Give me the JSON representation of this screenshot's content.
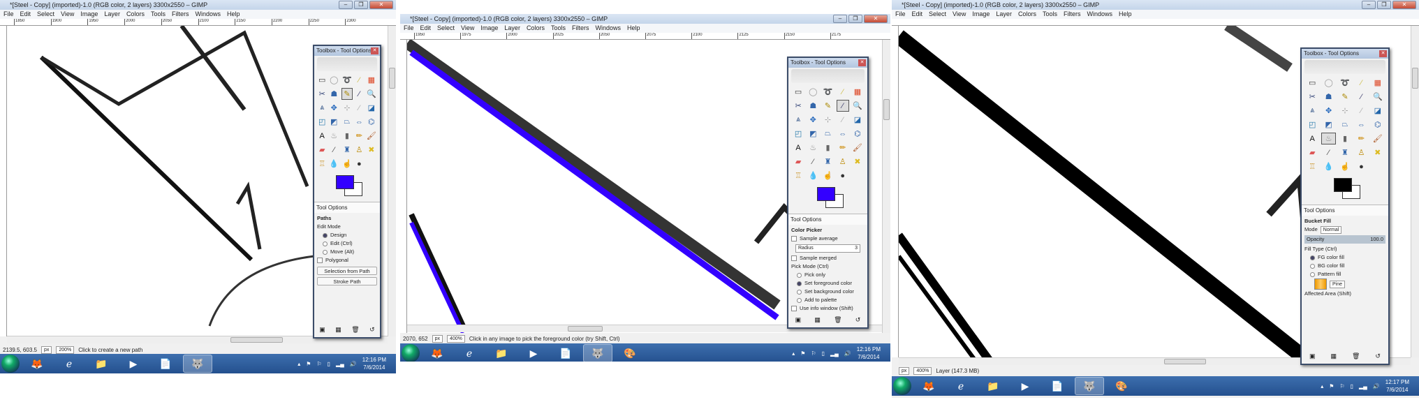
{
  "windows": [
    {
      "title": "*[Steel - Copy] (imported)-1.0 (RGB color, 2 layers) 3300x2550 – GIMP",
      "menu": [
        "File",
        "Edit",
        "Select",
        "View",
        "Image",
        "Layer",
        "Colors",
        "Tools",
        "Filters",
        "Windows",
        "Help"
      ],
      "ruler": [
        "1850",
        "1900",
        "1950",
        "2000",
        "2050",
        "2100",
        "2150",
        "2200",
        "2250",
        "2300"
      ],
      "status": {
        "coords": "2139.5, 603.5",
        "unit": "px",
        "zoom": "200%",
        "message": "Click to create a new path"
      },
      "toolbox": {
        "title": "Toolbox - Tool Options",
        "fg_color": "#3300ff",
        "active_tool": 7,
        "tab": "Tool Options",
        "options": {
          "heading": "Paths",
          "group": "Edit Mode",
          "radios": [
            "Design",
            "Edit (Ctrl)",
            "Move (Alt)"
          ],
          "checked": 0,
          "checkbox": "Polygonal",
          "buttons": [
            "Selection from Path",
            "Stroke Path"
          ]
        }
      },
      "taskbar": {
        "time": "12:16 PM",
        "date": "7/6/2014"
      }
    },
    {
      "title": "*[Steel - Copy] (imported)-1.0 (RGB color, 2 layers) 3300x2550 – GIMP",
      "menu": [
        "File",
        "Edit",
        "Select",
        "View",
        "Image",
        "Layer",
        "Colors",
        "Tools",
        "Filters",
        "Windows",
        "Help"
      ],
      "ruler": [
        "1950",
        "1975",
        "2000",
        "2025",
        "2050",
        "2075",
        "2100",
        "2125",
        "2150",
        "2175"
      ],
      "status": {
        "coords": "2070, 652",
        "unit": "px",
        "zoom": "400%",
        "message": "Click in any image to pick the foreground color (try Shift, Ctrl)"
      },
      "toolbox": {
        "title": "Toolbox - Tool Options",
        "fg_color": "#3300ff",
        "active_tool": 8,
        "tab": "Tool Options",
        "options": {
          "heading": "Color Picker",
          "checkboxes": [
            "Sample average",
            "Sample merged"
          ],
          "radius_label": "Radius",
          "radius_value": "3",
          "group": "Pick Mode (Ctrl)",
          "radios": [
            "Pick only",
            "Set foreground color",
            "Set background color",
            "Add to palette"
          ],
          "checked": 1,
          "checkbox": "Use info window (Shift)"
        }
      },
      "taskbar": {
        "time": "12:16 PM",
        "date": "7/6/2014"
      }
    },
    {
      "title": "*[Steel - Copy] (imported)-1.0 (RGB color, 2 layers) 3300x2550 – GIMP",
      "menu": [
        "File",
        "Edit",
        "Select",
        "View",
        "Image",
        "Layer",
        "Colors",
        "Tools",
        "Filters",
        "Windows",
        "Help"
      ],
      "ruler": [],
      "status": {
        "coords": "",
        "unit": "px",
        "zoom": "400%",
        "message": "Layer (147.3 MB)"
      },
      "toolbox": {
        "title": "Toolbox - Tool Options",
        "fg_color": "#000000",
        "active_tool": 21,
        "tab": "Tool Options",
        "options": {
          "heading": "Bucket Fill",
          "mode_label": "Mode",
          "mode_value": "Normal",
          "opacity_label": "Opacity",
          "opacity_value": "100.0",
          "group": "Fill Type (Ctrl)",
          "radios": [
            "FG color fill",
            "BG color fill",
            "Pattern fill"
          ],
          "checked": 0,
          "pattern_name": "Pine",
          "group2": "Affected Area (Shift)"
        }
      },
      "taskbar": {
        "time": "12:17 PM",
        "date": "7/6/2014"
      }
    }
  ],
  "tools": [
    {
      "icon": "rect-select-icon",
      "g": "▭",
      "c": "#333"
    },
    {
      "icon": "ellipse-select-icon",
      "g": "◯",
      "c": "#999"
    },
    {
      "icon": "free-select-icon",
      "g": "➰",
      "c": "#888"
    },
    {
      "icon": "fuzzy-select-icon",
      "g": "⁄",
      "c": "#cb4"
    },
    {
      "icon": "select-by-color-icon",
      "g": "▦",
      "c": "#d42"
    },
    {
      "icon": "scissors-select-icon",
      "g": "✂",
      "c": "#347"
    },
    {
      "icon": "foreground-select-icon",
      "g": "☗",
      "c": "#36a"
    },
    {
      "icon": "paths-icon",
      "g": "✎",
      "c": "#a80"
    },
    {
      "icon": "color-picker-icon",
      "g": "⁄",
      "c": "#336"
    },
    {
      "icon": "zoom-icon",
      "g": "🔍",
      "c": "#69c"
    },
    {
      "icon": "measure-icon",
      "g": "⩓",
      "c": "#358"
    },
    {
      "icon": "move-icon",
      "g": "✥",
      "c": "#26b"
    },
    {
      "icon": "align-icon",
      "g": "⊹",
      "c": "#999"
    },
    {
      "icon": "crop-icon",
      "g": "⁄",
      "c": "#aaa"
    },
    {
      "icon": "rotate-icon",
      "g": "◪",
      "c": "#26a"
    },
    {
      "icon": "scale-icon",
      "g": "◰",
      "c": "#27a"
    },
    {
      "icon": "shear-icon",
      "g": "◩",
      "c": "#36a"
    },
    {
      "icon": "perspective-icon",
      "g": "⏢",
      "c": "#36a"
    },
    {
      "icon": "flip-icon",
      "g": "⇔",
      "c": "#36a"
    },
    {
      "icon": "cage-icon",
      "g": "⌬",
      "c": "#36a"
    },
    {
      "icon": "text-icon",
      "g": "A",
      "c": "#111"
    },
    {
      "icon": "bucket-fill-icon",
      "g": "♨",
      "c": "#888"
    },
    {
      "icon": "blend-icon",
      "g": "▮",
      "c": "#666"
    },
    {
      "icon": "pencil-icon",
      "g": "✏",
      "c": "#c80"
    },
    {
      "icon": "paintbrush-icon",
      "g": "🖌",
      "c": "#a52"
    },
    {
      "icon": "eraser-icon",
      "g": "▰",
      "c": "#d55"
    },
    {
      "icon": "airbrush-icon",
      "g": "⁄",
      "c": "#444"
    },
    {
      "icon": "ink-icon",
      "g": "♜",
      "c": "#36a"
    },
    {
      "icon": "clone-icon",
      "g": "♙",
      "c": "#b80"
    },
    {
      "icon": "heal-icon",
      "g": "✖",
      "c": "#db2"
    },
    {
      "icon": "perspective-clone-icon",
      "g": "♖",
      "c": "#c93"
    },
    {
      "icon": "blur-icon",
      "g": "💧",
      "c": "#59c"
    },
    {
      "icon": "smudge-icon",
      "g": "☝",
      "c": "#c96"
    },
    {
      "icon": "dodge-burn-icon",
      "g": "●",
      "c": "#333"
    }
  ]
}
